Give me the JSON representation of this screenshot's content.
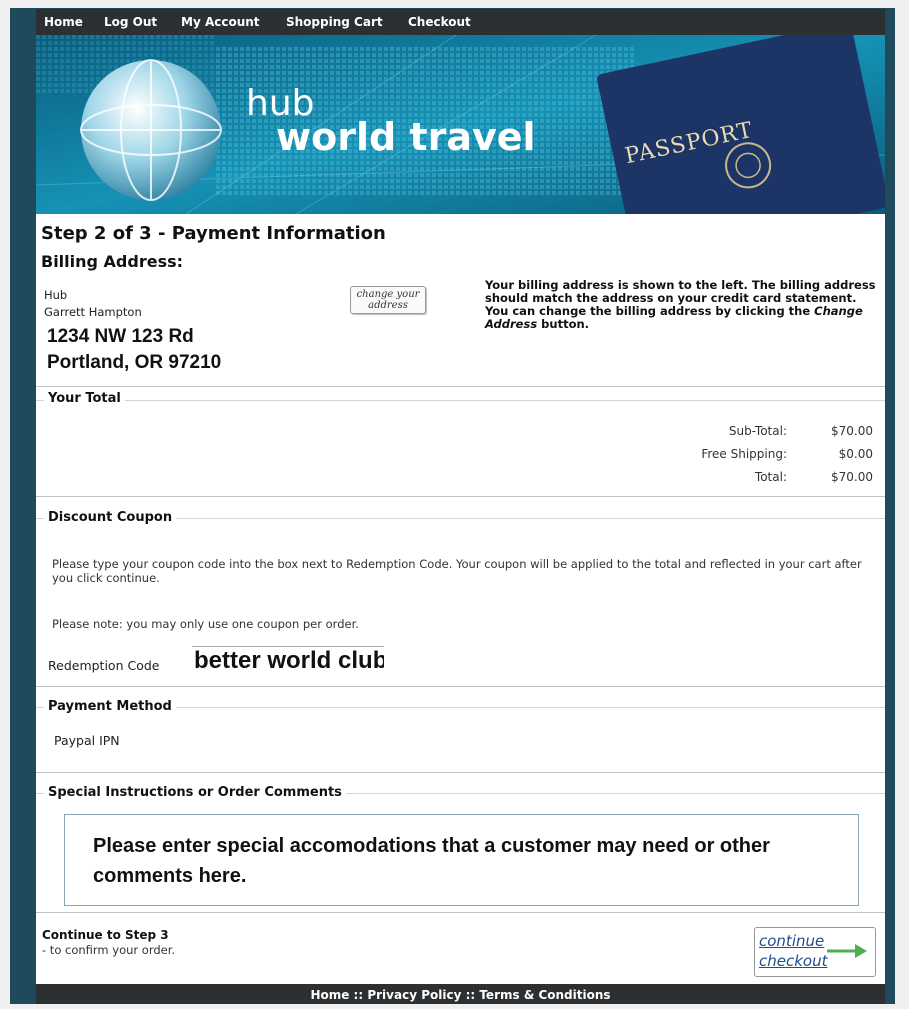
{
  "nav": {
    "links": [
      "Home",
      "Log Out",
      "My Account",
      "Shopping Cart",
      "Checkout"
    ]
  },
  "banner": {
    "logo_line1": "hub",
    "logo_line2": "world travel",
    "passport_text": "PASSPORT"
  },
  "step_title": "Step 2 of 3 - Payment Information",
  "billing": {
    "heading": "Billing Address:",
    "company": "Hub",
    "name": "Garrett Hampton",
    "street": "1234 NW 123 Rd",
    "city": "Portland, OR 97210",
    "change_button_label": "change your address",
    "note_before": "Your billing address is shown to the left. The billing address should match the address on your credit card statement. You can change the billing address by clicking the ",
    "note_emphasis": "Change Address",
    "note_after": " button."
  },
  "totals": {
    "legend": "Your Total",
    "rows": [
      {
        "label": "Sub-Total:",
        "value": "$70.00"
      },
      {
        "label": "Free Shipping:",
        "value": "$0.00"
      },
      {
        "label": "Total:",
        "value": "$70.00"
      }
    ]
  },
  "coupon": {
    "legend": "Discount Coupon",
    "instructions": "Please type your coupon code into the box next to Redemption Code. Your coupon will be applied to the total and reflected in your cart after you click continue.",
    "note": "Please note: you may only use one coupon per order.",
    "field_label": "Redemption Code",
    "field_value": "better world club"
  },
  "payment": {
    "legend": "Payment Method",
    "method": "Paypal IPN"
  },
  "comments": {
    "legend": "Special Instructions or Order Comments",
    "text": "Please enter special accomodations that a customer may need or other comments here."
  },
  "continue": {
    "title": "Continue to Step 3",
    "subtitle": "- to confirm your order.",
    "button_line1": "continue",
    "button_line2": "checkout"
  },
  "footer": {
    "home": "Home",
    "sep1": " :: ",
    "privacy": "Privacy Policy",
    "sep2": " :: ",
    "terms": "Terms & Conditions"
  },
  "colors": {
    "frame": "#1f4a5c",
    "bars": "#2c3033",
    "banner_bg": "#0f6e8f",
    "passport": "#1d3566",
    "button_text": "#1f4d8f",
    "arrow": "#4caf50"
  }
}
